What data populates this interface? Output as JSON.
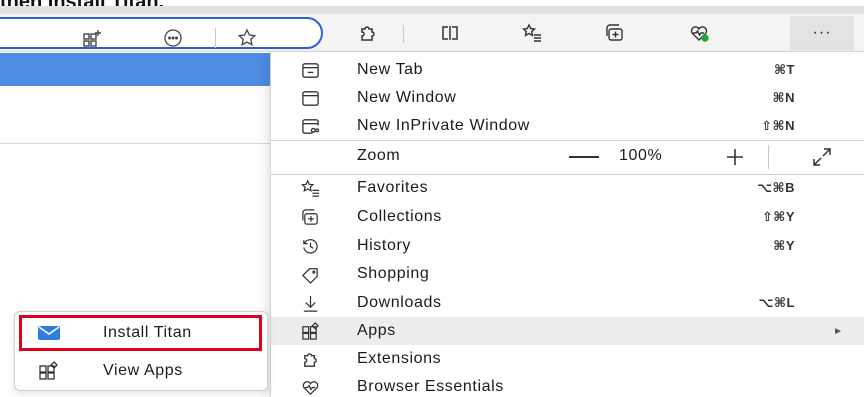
{
  "heading": "then Install Titan.",
  "colors": {
    "accent": "#2a63d6",
    "page_blue": "#4f8ce4",
    "callout": "#e0001b",
    "highlight": "#ededed"
  },
  "toolbar": {
    "icons": [
      "add-tab-icon",
      "emoji-icon",
      "star-icon",
      "puzzle-icon",
      "split-screen-icon",
      "favorites-list-icon",
      "collections-icon",
      "heart-pulse-icon"
    ],
    "more_label": "···"
  },
  "menu": {
    "new_tab": {
      "label": "New Tab",
      "shortcut": "⌘T"
    },
    "new_window": {
      "label": "New Window",
      "shortcut": "⌘N"
    },
    "new_inprivate": {
      "label": "New InPrivate Window",
      "shortcut": "⇧⌘N"
    },
    "zoom": {
      "label": "Zoom",
      "value": "100%"
    },
    "favorites": {
      "label": "Favorites",
      "shortcut": "⌥⌘B"
    },
    "collections": {
      "label": "Collections",
      "shortcut": "⇧⌘Y"
    },
    "history": {
      "label": "History",
      "shortcut": "⌘Y"
    },
    "shopping": {
      "label": "Shopping"
    },
    "downloads": {
      "label": "Downloads",
      "shortcut": "⌥⌘L"
    },
    "apps": {
      "label": "Apps",
      "arrow": "►"
    },
    "extensions": {
      "label": "Extensions"
    },
    "browser_essentials": {
      "label": "Browser Essentials"
    }
  },
  "submenu": {
    "install_titan": {
      "label": "Install Titan"
    },
    "view_apps": {
      "label": "View Apps"
    }
  }
}
